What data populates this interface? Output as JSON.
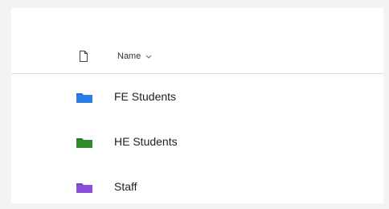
{
  "header": {
    "name_label": "Name"
  },
  "colors": {
    "fe_folder": "#1E6FD9",
    "he_folder": "#2E8B2E",
    "staff_folder": "#8B4FD9"
  },
  "folders": [
    {
      "name": "FE Students",
      "icon": "blue-folder-icon"
    },
    {
      "name": "HE Students",
      "icon": "green-folder-icon"
    },
    {
      "name": "Staff",
      "icon": "purple-folder-icon"
    }
  ]
}
